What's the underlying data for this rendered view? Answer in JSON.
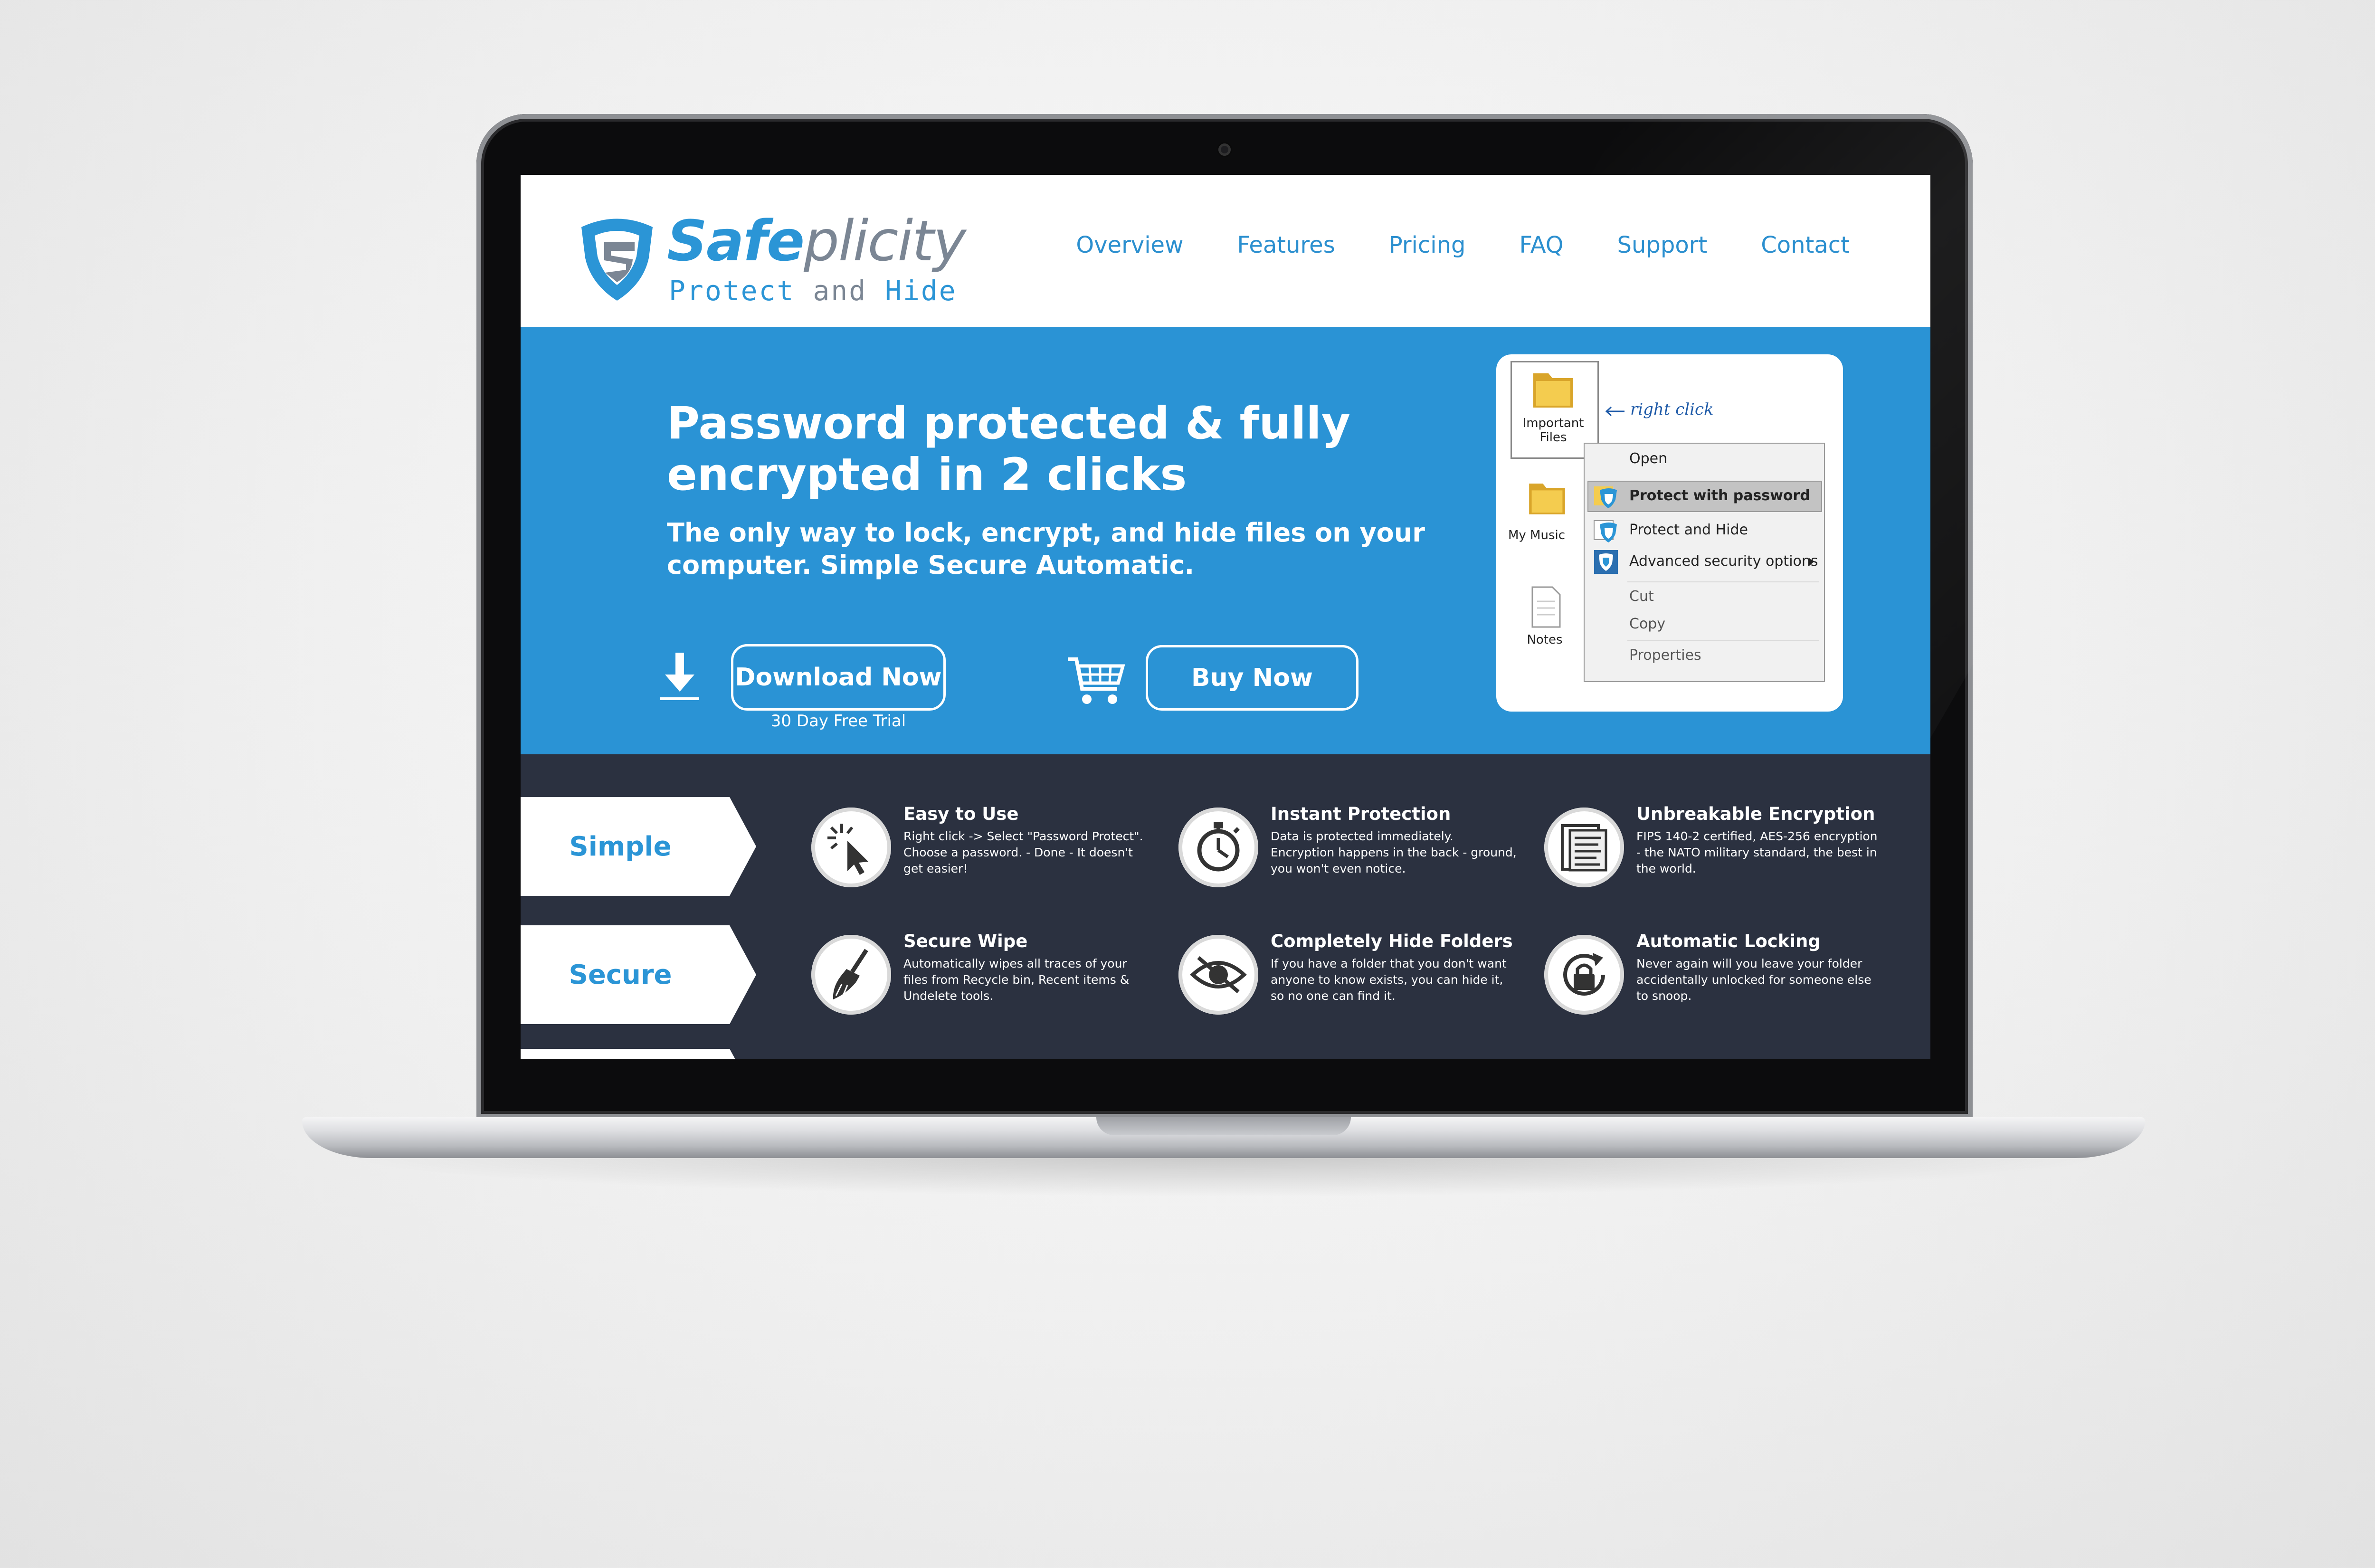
{
  "brand": {
    "name_bold": "Safe",
    "name_light": "plicity",
    "tagline_main": "Protect",
    "tagline_mid": "and",
    "tagline_end": "Hide"
  },
  "nav": {
    "items": [
      {
        "label": "Overview"
      },
      {
        "label": "Features"
      },
      {
        "label": "Pricing"
      },
      {
        "label": "FAQ"
      },
      {
        "label": "Support"
      },
      {
        "label": "Contact"
      }
    ]
  },
  "hero": {
    "title": "Password protected & fully encrypted in 2 clicks",
    "subtitle": "The only way to lock, encrypt, and hide files on your computer. Simple Secure Automatic.",
    "download_label": "Download Now",
    "trial_note": "30 Day Free Trial",
    "buy_label": "Buy Now"
  },
  "illustration": {
    "folder_important": "Important Files",
    "folder_music": "My Music",
    "file_notes": "Notes",
    "right_click_note": "right click",
    "menu": {
      "open": "Open",
      "protect_password": "Protect with password",
      "protect_hide": "Protect and Hide",
      "advanced": "Advanced security options",
      "cut": "Cut",
      "copy": "Copy",
      "properties": "Properties"
    }
  },
  "ribbons": [
    {
      "label": "Simple"
    },
    {
      "label": "Secure"
    }
  ],
  "features": [
    {
      "title": "Easy to Use",
      "text": "Right click -> Select \"Password Protect\". Choose a password. - Done - It doesn't get easier!",
      "icon": "cursor-click-icon"
    },
    {
      "title": "Instant Protection",
      "text": "Data is protected immediately. Encryption happens in the back - ground, you won't even notice.",
      "icon": "stopwatch-icon"
    },
    {
      "title": "Unbreakable Encryption",
      "text": "FIPS 140-2 certified, AES-256 encryption - the NATO military standard, the best in the world.",
      "icon": "encrypted-document-icon"
    },
    {
      "title": "Secure Wipe",
      "text": "Automatically wipes all traces of your files from Recycle bin, Recent items & Undelete tools.",
      "icon": "broom-icon"
    },
    {
      "title": "Completely Hide Folders",
      "text": "If you have a folder that you don't want anyone to know exists, you can hide it, so no one can find it.",
      "icon": "hidden-eye-icon"
    },
    {
      "title": "Automatic Locking",
      "text": "Never again will you leave your folder accidentally unlocked for someone else to snoop.",
      "icon": "auto-lock-icon"
    }
  ],
  "colors": {
    "brand_blue": "#2a93d5",
    "dark_band": "#2b3140",
    "logo_gray": "#7b8694"
  }
}
